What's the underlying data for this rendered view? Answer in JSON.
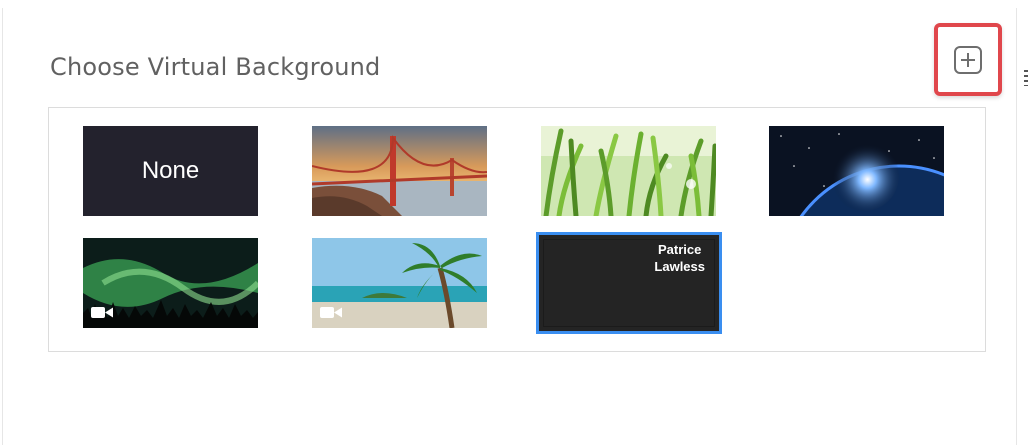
{
  "header": {
    "title": "Choose Virtual Background"
  },
  "backgrounds": [
    {
      "id": "none",
      "label": "None"
    },
    {
      "id": "golden-gate"
    },
    {
      "id": "grass"
    },
    {
      "id": "earth"
    },
    {
      "id": "aurora",
      "video": true
    },
    {
      "id": "beach",
      "video": true
    },
    {
      "id": "name-card",
      "name_line1": "Patrice",
      "name_line2": "Lawless",
      "selected": true
    }
  ],
  "colors": {
    "highlight_border": "#e0474c",
    "selected_outline": "#3a8ef0",
    "dark_thumb": "#23222d"
  }
}
